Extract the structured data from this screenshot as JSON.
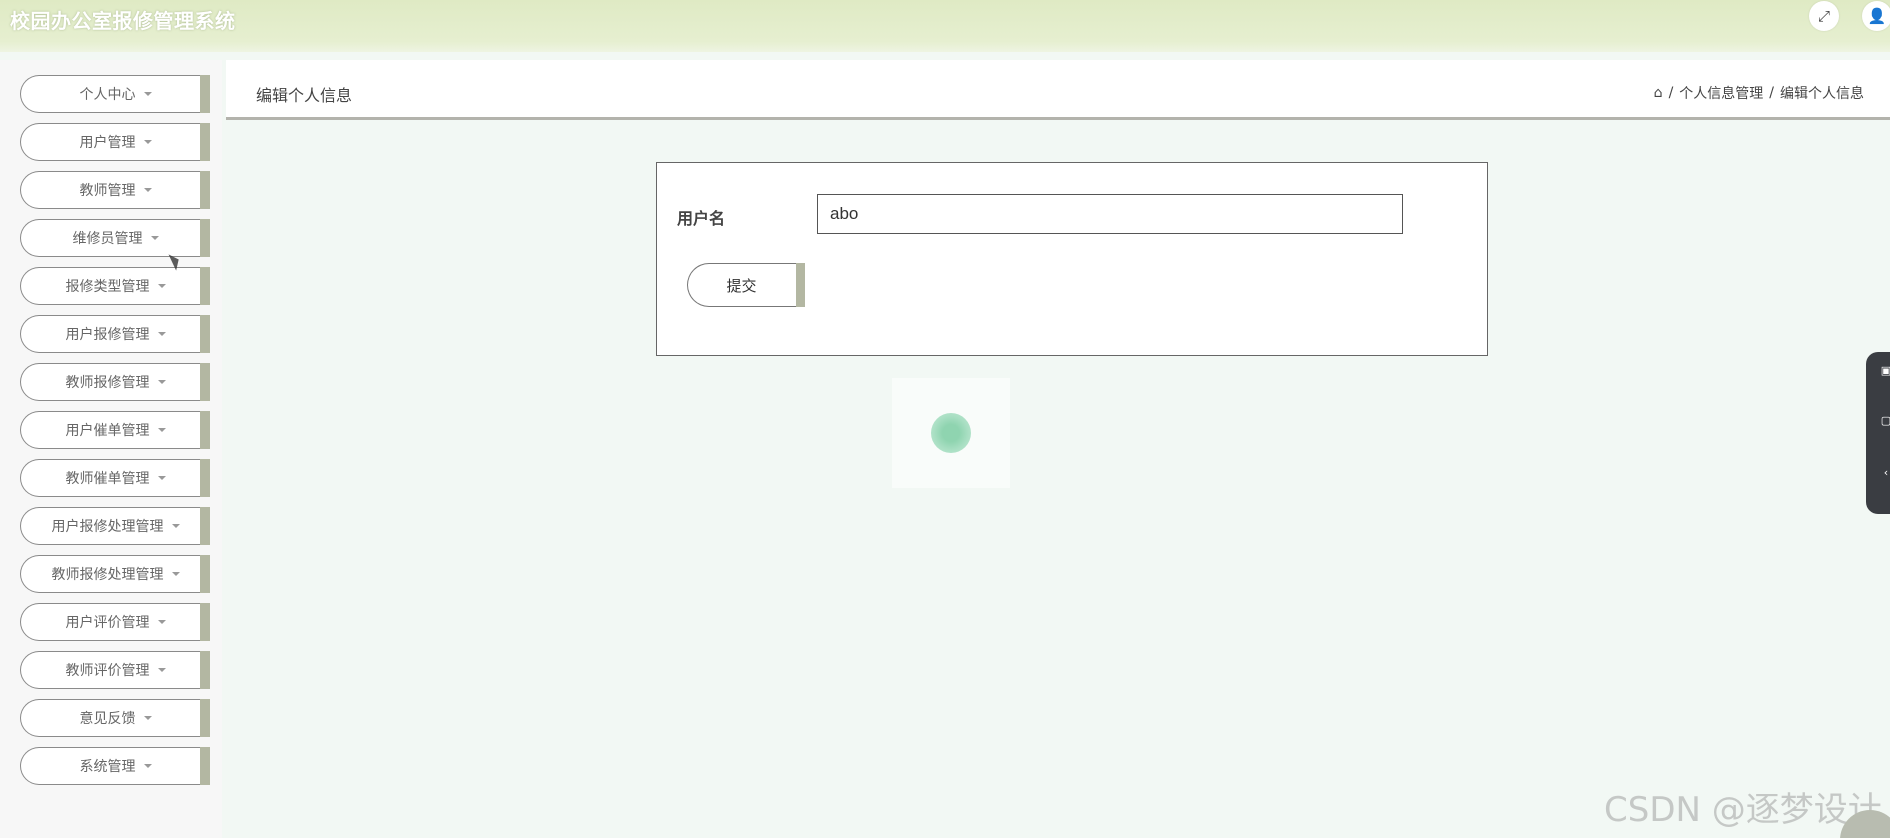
{
  "header": {
    "app_title": "校园办公室报修管理系统",
    "fullscreen_icon": "fullscreen-icon",
    "user_icon": "user-icon"
  },
  "sidebar": {
    "items": [
      {
        "label": "个人中心"
      },
      {
        "label": "用户管理"
      },
      {
        "label": "教师管理"
      },
      {
        "label": "维修员管理"
      },
      {
        "label": "报修类型管理"
      },
      {
        "label": "用户报修管理"
      },
      {
        "label": "教师报修管理"
      },
      {
        "label": "用户催单管理"
      },
      {
        "label": "教师催单管理"
      },
      {
        "label": "用户报修处理管理"
      },
      {
        "label": "教师报修处理管理"
      },
      {
        "label": "用户评价管理"
      },
      {
        "label": "教师评价管理"
      },
      {
        "label": "意见反馈"
      },
      {
        "label": "系统管理"
      }
    ]
  },
  "main": {
    "page_title": "编辑个人信息",
    "breadcrumb": {
      "home_icon": "home-icon",
      "items": [
        "个人信息管理",
        "编辑个人信息"
      ],
      "separator": "/"
    },
    "form": {
      "username_label": "用户名",
      "username_value": "abo",
      "submit_label": "提交"
    }
  },
  "watermark": "CSDN @逐梦设计",
  "colors": {
    "header_bg": "#dfeac4",
    "content_bg": "#f2f8f4",
    "button_accent": "#b3b7a2"
  }
}
